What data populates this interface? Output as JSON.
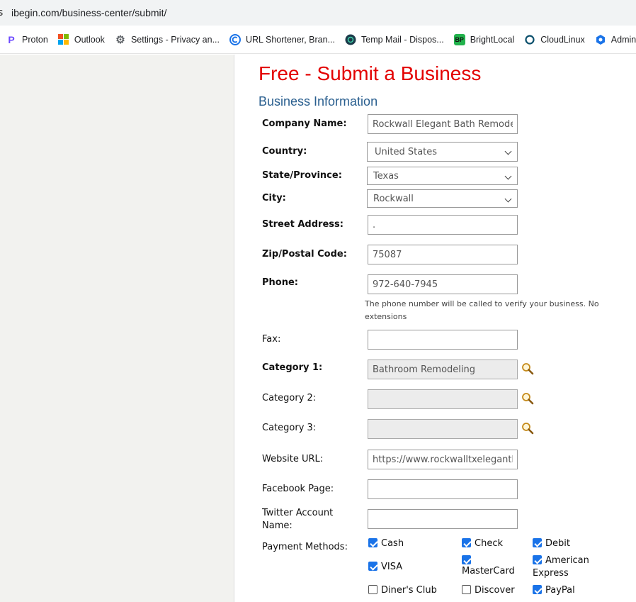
{
  "browser": {
    "url": "ibegin.com/business-center/submit/",
    "left_glyph": "s",
    "bookmarks": [
      {
        "label": "Proton",
        "icon": "proton-icon",
        "color": "#6d4aff"
      },
      {
        "label": "Outlook",
        "icon": "outlook-icon",
        "color": "#0078d4"
      },
      {
        "label": "Settings - Privacy an...",
        "icon": "gear-icon",
        "color": "#5f6368"
      },
      {
        "label": "URL Shortener, Bran...",
        "icon": "url-shortener-icon",
        "color": "#1a73e8"
      },
      {
        "label": "Temp Mail - Dispos...",
        "icon": "temp-mail-icon",
        "color": "#1b3b4a"
      },
      {
        "label": "BrightLocal",
        "icon": "brightlocal-icon",
        "color": "#22b24c"
      },
      {
        "label": "CloudLinux",
        "icon": "cloudlinux-icon",
        "color": "#0b4f6c"
      },
      {
        "label": "Admin",
        "icon": "admin-icon",
        "color": "#1a73e8"
      }
    ]
  },
  "page": {
    "title": "Free - Submit a Business",
    "section": "Business Information"
  },
  "form": {
    "company_name": {
      "label": "Company Name:",
      "value": "Rockwall Elegant Bath Remodel"
    },
    "country": {
      "label": "Country:",
      "value": "United States"
    },
    "state": {
      "label": "State/Province:",
      "value": "Texas"
    },
    "city": {
      "label": "City:",
      "value": "Rockwall"
    },
    "street": {
      "label": "Street Address:",
      "value": "."
    },
    "zip": {
      "label": "Zip/Postal Code:",
      "value": "75087"
    },
    "phone": {
      "label": "Phone:",
      "value": "972-640-7945",
      "note": "The phone number will be called to verify your business. No extensions"
    },
    "fax": {
      "label": "Fax:",
      "value": ""
    },
    "category1": {
      "label": "Category 1:",
      "value": "Bathroom Remodeling"
    },
    "category2": {
      "label": "Category 2:",
      "value": ""
    },
    "category3": {
      "label": "Category 3:",
      "value": ""
    },
    "website": {
      "label": "Website URL:",
      "value": "https://www.rockwalltxelegantbathremodel.com"
    },
    "facebook": {
      "label": "Facebook Page:",
      "value": ""
    },
    "twitter": {
      "label": "Twitter Account Name:",
      "value": ""
    },
    "payment": {
      "label": "Payment Methods:",
      "options": [
        {
          "label": "Cash",
          "checked": true
        },
        {
          "label": "Check",
          "checked": true
        },
        {
          "label": "Debit",
          "checked": true
        },
        {
          "label": "VISA",
          "checked": true
        },
        {
          "label": "MasterCard",
          "checked": true
        },
        {
          "label": "American Express",
          "checked": true
        },
        {
          "label": "Diner's Club",
          "checked": false
        },
        {
          "label": "Discover",
          "checked": false
        },
        {
          "label": "PayPal",
          "checked": true
        }
      ]
    }
  }
}
